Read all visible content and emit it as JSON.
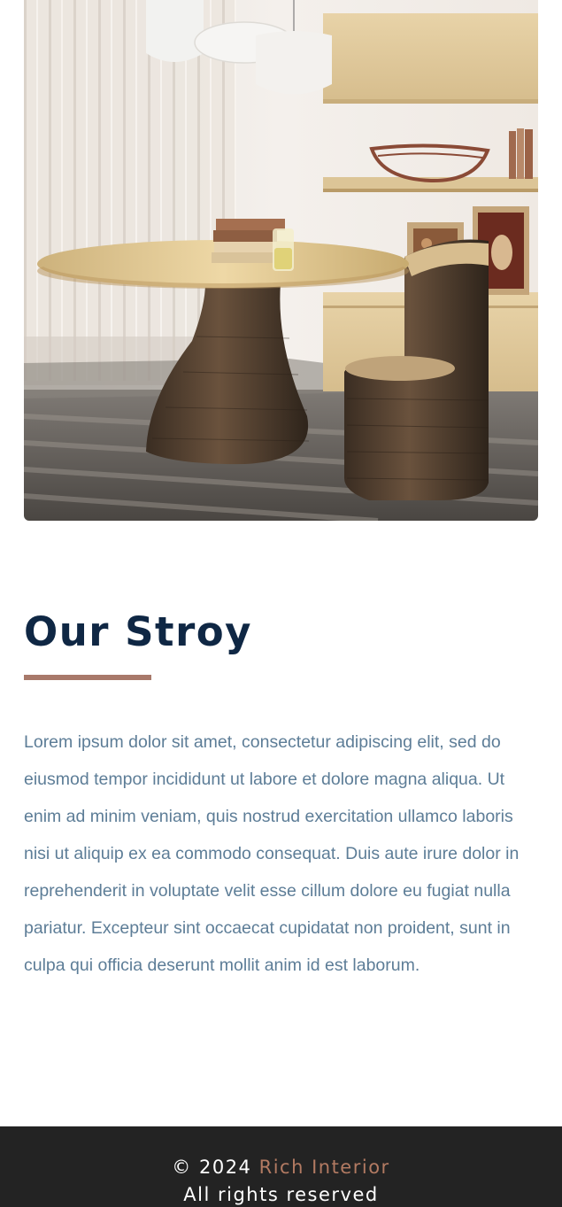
{
  "hero": {
    "alt": "Interior with round wooden table and chair"
  },
  "story": {
    "title": "Our Stroy",
    "body": "Lorem ipsum dolor sit amet, consectetur adipiscing elit, sed do eiusmod tempor incididunt ut labore et dolore magna aliqua. Ut enim ad minim veniam, quis nostrud exercitation ullamco laboris nisi ut aliquip ex ea commodo consequat. Duis aute irure dolor in reprehenderit in voluptate velit esse cillum dolore eu fugiat nulla pariatur. Excepteur sint occaecat cupidatat non proident, sunt in culpa qui officia deserunt mollit anim id est laborum."
  },
  "footer": {
    "copyright": "© 2024",
    "brand": "Rich Interior",
    "rights": "All rights reserved"
  },
  "colors": {
    "title": "#0f2744",
    "accent": "#a8796a",
    "body_text": "#5d7d97",
    "footer_bg": "#232323",
    "brand": "#b27a62"
  }
}
